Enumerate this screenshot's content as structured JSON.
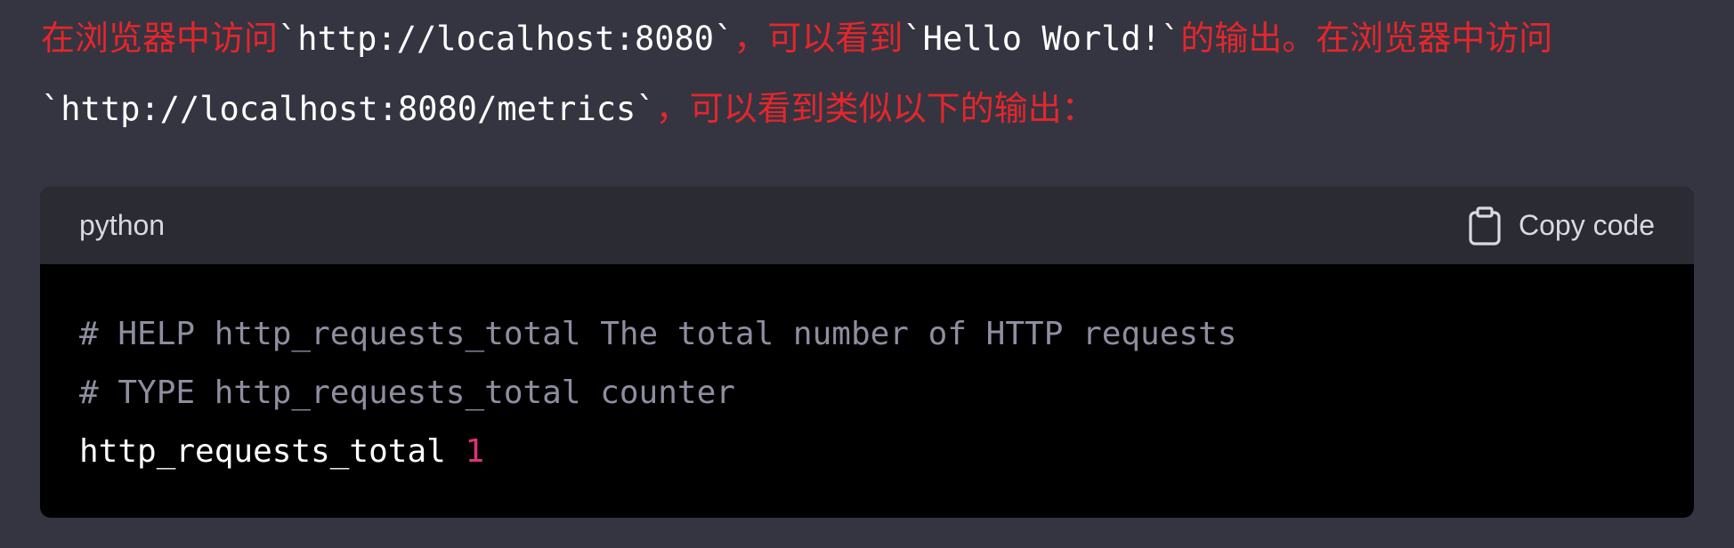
{
  "message": {
    "t1": "在浏览器中访问",
    "c1": "`http://localhost:8080`",
    "t2": "，可以看到",
    "c2": "`Hello World!`",
    "t3": "的输出。在浏览器中访问",
    "c3": "`http://localhost:8080/metrics`",
    "t4": "，可以看到类似以下的输出："
  },
  "code_block": {
    "language": "python",
    "copy_label": "Copy code",
    "copy_icon": "clipboard-icon",
    "lines": {
      "help": "# HELP http_requests_total The total number of HTTP requests",
      "type": "# TYPE http_requests_total counter",
      "metric_name": "http_requests_total",
      "metric_value": "1"
    }
  },
  "colors": {
    "background": "#343541",
    "prose_text": "#e5262b",
    "code_background": "#000000",
    "code_header": "#2b2b33",
    "comment": "#8e8ea0",
    "number": "#df3079"
  }
}
